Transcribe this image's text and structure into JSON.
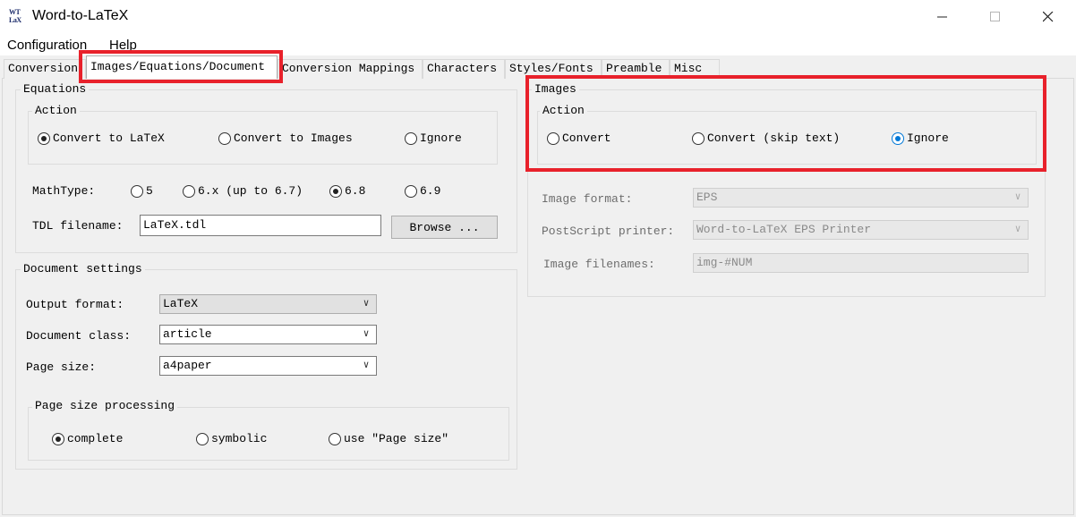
{
  "window": {
    "title": "Word-to-LaTeX",
    "icon": "word-to-latex-app-icon",
    "icon_text": [
      "WT",
      "LaX"
    ]
  },
  "menu": [
    "Configuration",
    "Help"
  ],
  "tabs": [
    "Conversion",
    "Images/Equations/Document",
    "Conversion Mappings",
    "Characters",
    "Styles/Fonts",
    "Preamble",
    "Misc"
  ],
  "active_tab": "Images/Equations/Document",
  "equations": {
    "title": "Equations",
    "action": {
      "title": "Action",
      "options": [
        "Convert to LaTeX",
        "Convert to Images",
        "Ignore"
      ],
      "selected": "Convert to LaTeX"
    },
    "mathtype": {
      "label": "MathType:",
      "options": [
        "5",
        "6.x (up to 6.7)",
        "6.8",
        "6.9"
      ],
      "selected": "6.8"
    },
    "tdl": {
      "label": "TDL filename:",
      "value": "LaTeX.tdl",
      "browse": "Browse ..."
    }
  },
  "document": {
    "title": "Document settings",
    "output_format": {
      "label": "Output format:",
      "value": "LaTeX"
    },
    "document_class": {
      "label": "Document class:",
      "value": "article"
    },
    "page_size": {
      "label": "Page size:",
      "value": "a4paper"
    },
    "processing": {
      "title": "Page size processing",
      "options": [
        "complete",
        "symbolic",
        "use \"Page size\""
      ],
      "selected": "complete"
    }
  },
  "images": {
    "title": "Images",
    "action": {
      "title": "Action",
      "options": [
        "Convert",
        "Convert (skip text)",
        "Ignore"
      ],
      "selected": "Ignore"
    },
    "image_format": {
      "label": "Image format:",
      "value": "EPS"
    },
    "postscript_printer": {
      "label": "PostScript printer:",
      "value": "Word-to-LaTeX EPS Printer"
    },
    "image_filenames": {
      "label": "Image filenames:",
      "value": "img-#NUM"
    }
  },
  "colors": {
    "highlight": "#e8212b",
    "selected_blue": "#0078d7"
  }
}
